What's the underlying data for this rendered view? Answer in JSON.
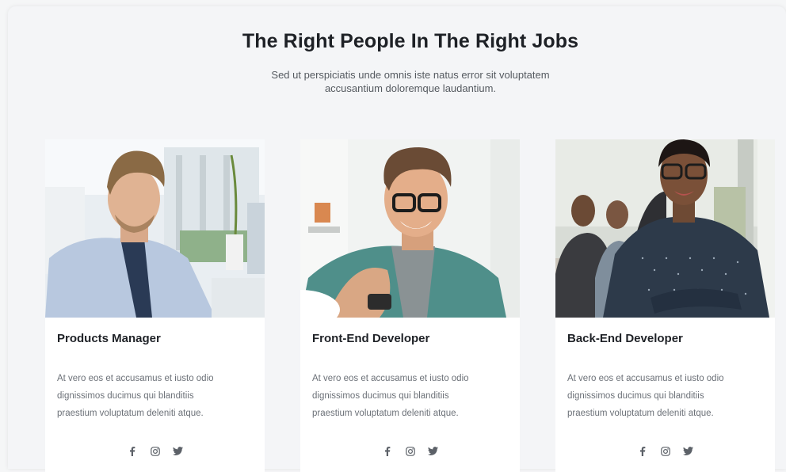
{
  "section": {
    "title": "The Right People In The Right Jobs",
    "subtitle_line1": "Sed ut perspiciatis unde omnis iste natus error sit voluptatem",
    "subtitle_line2": "accusantium doloremque laudantium."
  },
  "cards": [
    {
      "role": "Products Manager",
      "desc_line1": "At vero eos et accusamus et iusto odio",
      "desc_line2": "dignissimos ducimus qui blanditiis",
      "desc_line3": "praestium voluptatum deleniti atque.",
      "photo": "man-in-blue-shirt-photo"
    },
    {
      "role": "Front-End Developer",
      "desc_line1": "At vero eos et accusamus et iusto odio",
      "desc_line2": "dignissimos ducimus qui blanditiis",
      "desc_line3": "praestium voluptatum deleniti atque.",
      "photo": "man-with-glasses-photo"
    },
    {
      "role": "Back-End Developer",
      "desc_line1": "At vero eos et accusamus et iusto odio",
      "desc_line2": "dignissimos ducimus qui blanditiis",
      "desc_line3": "praestium voluptatum deleniti atque.",
      "photo": "woman-with-glasses-photo"
    }
  ],
  "social_icons": [
    "facebook-icon",
    "instagram-icon",
    "twitter-icon"
  ],
  "colors": {
    "background": "#f4f5f7",
    "card": "#ffffff",
    "heading": "#1e2126",
    "body_text": "#6c7178"
  }
}
